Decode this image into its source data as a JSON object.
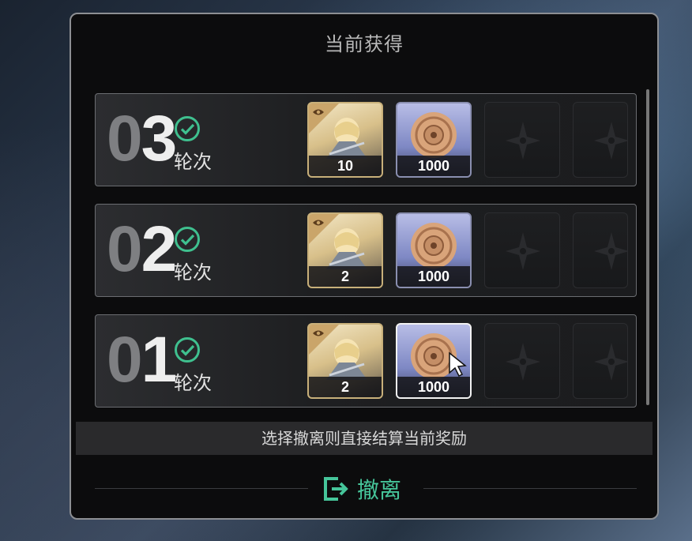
{
  "panel": {
    "title": "当前获得"
  },
  "rounds": [
    {
      "num_dim": "0",
      "num_bright": "3",
      "label": "轮次",
      "completed": true,
      "rewards": [
        {
          "type": "character",
          "qty": "10"
        },
        {
          "type": "coin",
          "qty": "1000",
          "selected": false
        },
        {
          "type": "empty"
        },
        {
          "type": "empty"
        }
      ]
    },
    {
      "num_dim": "0",
      "num_bright": "2",
      "label": "轮次",
      "completed": true,
      "rewards": [
        {
          "type": "character",
          "qty": "2"
        },
        {
          "type": "coin",
          "qty": "1000",
          "selected": false
        },
        {
          "type": "empty"
        },
        {
          "type": "empty"
        }
      ]
    },
    {
      "num_dim": "0",
      "num_bright": "1",
      "label": "轮次",
      "completed": true,
      "rewards": [
        {
          "type": "character",
          "qty": "2"
        },
        {
          "type": "coin",
          "qty": "1000",
          "selected": true
        },
        {
          "type": "empty"
        },
        {
          "type": "empty"
        }
      ]
    }
  ],
  "notice": "选择撤离则直接结算当前奖励",
  "retreat": {
    "label": "撤离",
    "icon": "exit-icon"
  },
  "colors": {
    "accent": "#46c59a",
    "check": "#3fc08f",
    "badge": "#caa56a"
  }
}
